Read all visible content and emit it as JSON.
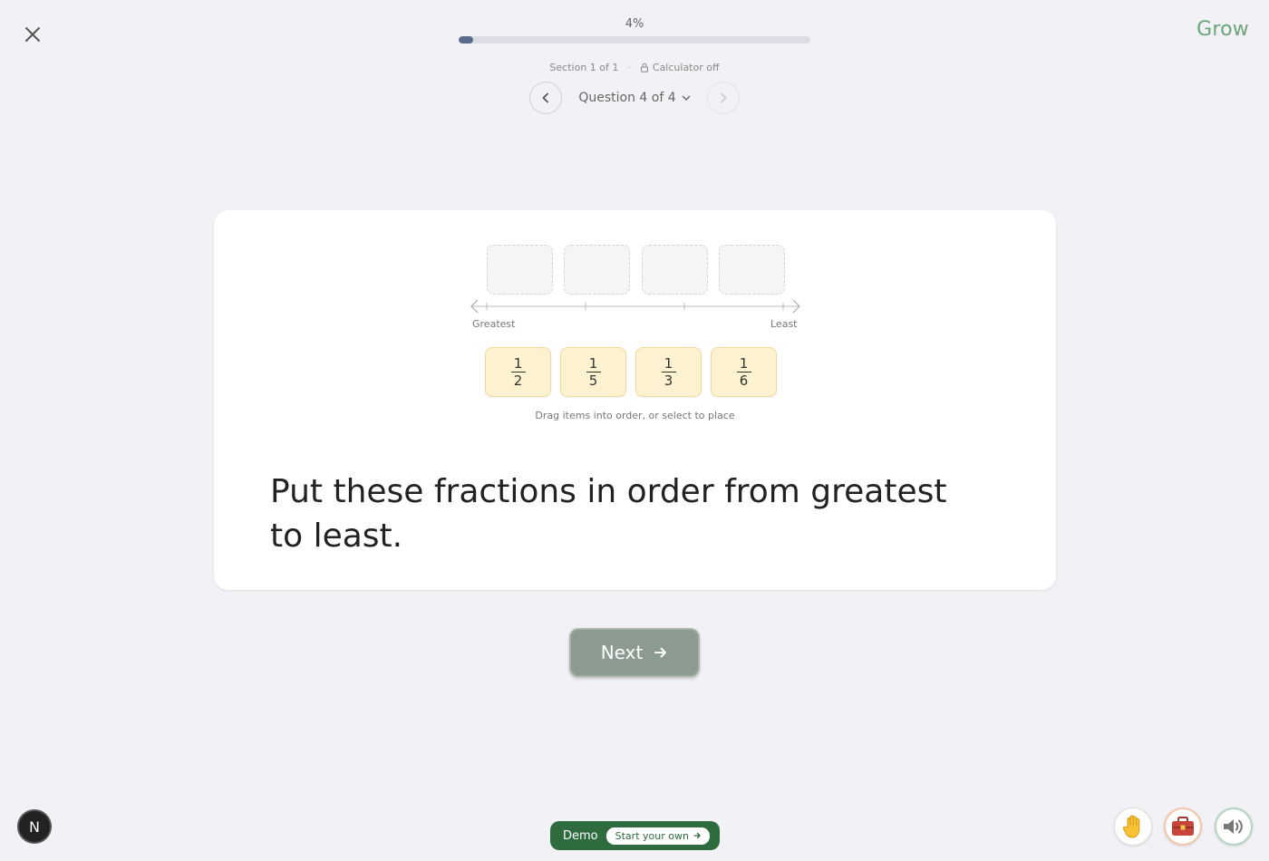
{
  "header": {
    "brand": "Grow",
    "progress_text": "4%",
    "progress_value": 0.04,
    "section_text": "Section 1 of 1",
    "separator": "·",
    "calculator_text": "Calculator off",
    "question_nav_label": "Question 4 of 4"
  },
  "activity": {
    "slots_count": 4,
    "axis_left_label": "Greatest",
    "axis_right_label": "Least",
    "tiles": [
      {
        "numerator": "1",
        "denominator": "2"
      },
      {
        "numerator": "1",
        "denominator": "5"
      },
      {
        "numerator": "1",
        "denominator": "3"
      },
      {
        "numerator": "1",
        "denominator": "6"
      }
    ],
    "hint": "Drag items into order, or select to place",
    "question": "Put these fractions in order from greatest to least."
  },
  "footer": {
    "next_label": "Next",
    "avatar_letter": "N",
    "demo_label": "Demo",
    "demo_cta": "Start your own"
  },
  "colors": {
    "brand": "#6aa57a",
    "progress_fill": "#5a6b8c",
    "tile_bg": "#fdf2d0",
    "next_bg": "#8d9a91",
    "demo_bg": "#2e6b3e"
  },
  "icons": [
    "close-icon",
    "chevron-left-icon",
    "chevron-down-icon",
    "chevron-right-icon",
    "lock-icon",
    "arrow-right-icon",
    "hand-icon",
    "toolkit-icon",
    "speaker-icon"
  ]
}
